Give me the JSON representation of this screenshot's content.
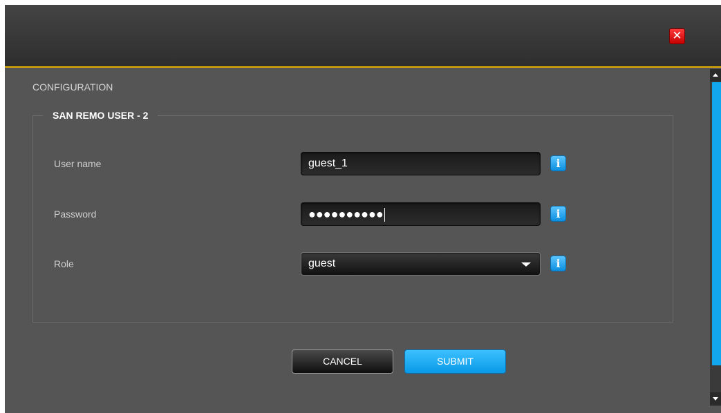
{
  "dialog": {
    "close_icon": "close-icon",
    "close_glyph": "✕"
  },
  "page": {
    "section_title": "CONFIGURATION"
  },
  "form": {
    "legend": "SAN REMO USER - 2",
    "user_name": {
      "label": "User name",
      "value": "guest_1"
    },
    "password": {
      "label": "Password",
      "masked_value": "●●●●●●●●●●",
      "length": 10
    },
    "role": {
      "label": "Role",
      "value": "guest"
    },
    "info_glyph": "i"
  },
  "buttons": {
    "cancel": "CANCEL",
    "submit": "SUBMIT"
  },
  "colors": {
    "accent_blue": "#12a6ef",
    "title_border": "#e2b000",
    "close_red": "#e00000",
    "background": "#555555"
  }
}
